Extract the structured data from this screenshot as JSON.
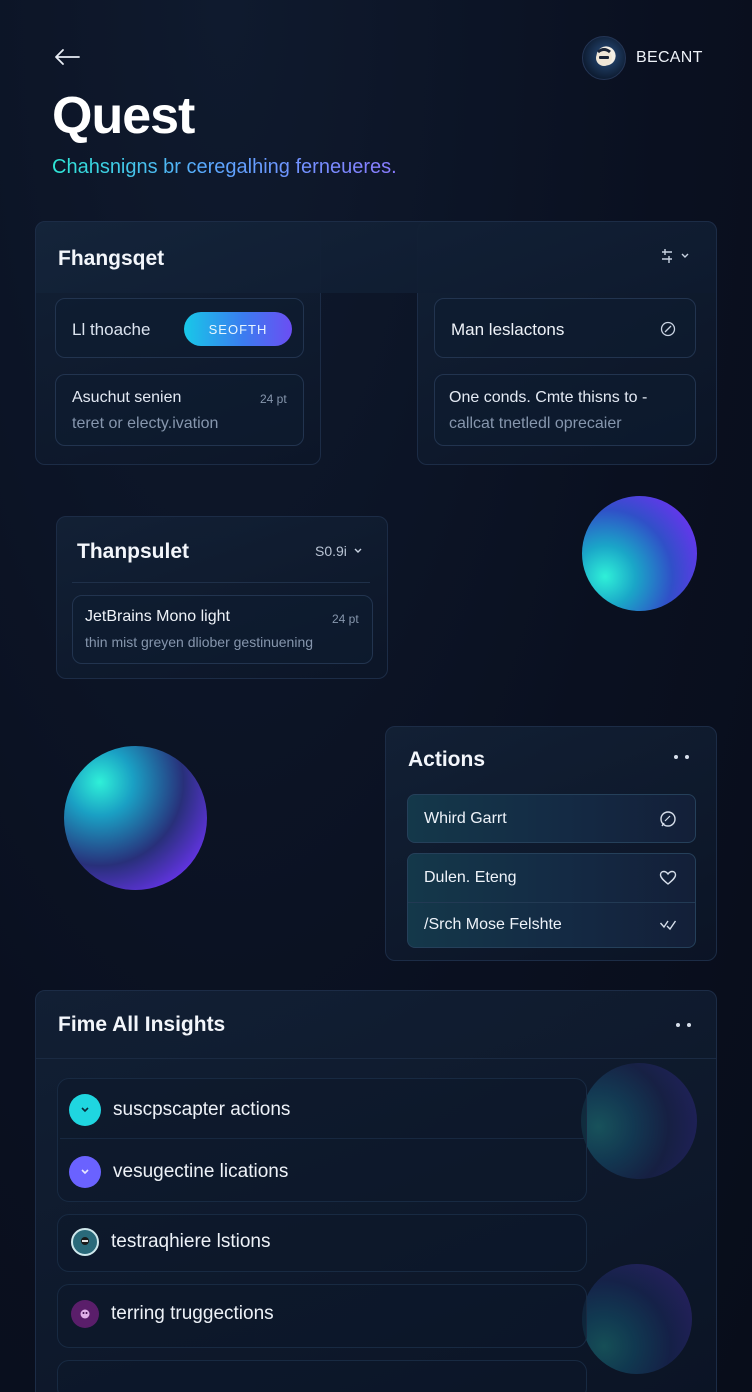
{
  "header": {
    "title": "Quest",
    "subtitle": "Chahsnigns br ceregalhing ferneueres.",
    "profile_name": "BECANT"
  },
  "card1": {
    "title": "Fhangsqet",
    "left": {
      "field1_label": "Ll thoache",
      "button_label": "SEOFTH",
      "field2_line1": "Asuchut senien",
      "field2_line2": "teret or electy.ivation",
      "field2_meta": "24 pt"
    },
    "right": {
      "field1_label": "Man leslactons",
      "field2_line1": "One conds. Cmte thisns to -",
      "field2_line2": "callcat tnetledl oprecaier"
    }
  },
  "card2": {
    "title": "Thanpsulet",
    "value": "S0.9i",
    "font_name": "JetBrains Mono light",
    "font_size": "24 pt",
    "font_desc": "thin mist greyen dliober gestinuening"
  },
  "actions": {
    "title": "Actions",
    "items": [
      {
        "label": "Whird Garrt",
        "icon": "chat-icon"
      },
      {
        "label": "Dulen. Eteng",
        "icon": "heart-icon"
      },
      {
        "label": "/Srch Mose Felshte",
        "icon": "check-icon"
      }
    ]
  },
  "insights": {
    "title": "Fime All Insights",
    "items": [
      {
        "label": "suscpscapter actions",
        "icon_color": "#1fd6e0"
      },
      {
        "label": "vesugectine lications",
        "icon_color": "#6a62ff"
      },
      {
        "label": "testraqhiere lstions",
        "icon_color": "#2a6a7a"
      },
      {
        "label": "terring truggections",
        "icon_color": "#5a1e6a"
      }
    ]
  }
}
